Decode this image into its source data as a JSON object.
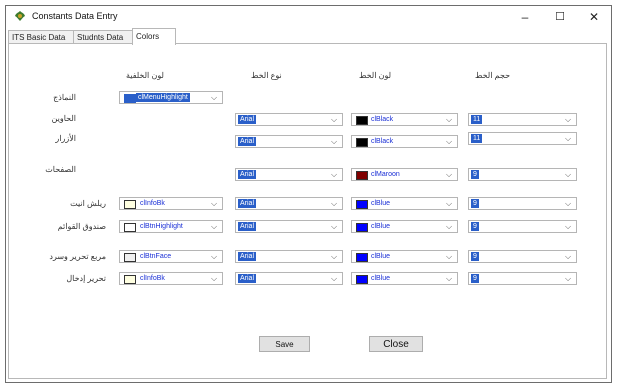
{
  "window": {
    "title": "Constants Data Entry",
    "controls": {
      "minimize": "–",
      "maximize": "☐",
      "close": "✕"
    }
  },
  "tabs": [
    {
      "label": "ITS Basic Data",
      "active": false
    },
    {
      "label": "Studnts Data",
      "active": false
    },
    {
      "label": "Colors",
      "active": true
    }
  ],
  "headers": {
    "background_color": "لون الخلفية",
    "font_type": "نوع الخط",
    "font_color": "لون الخط",
    "font_size": "حجم الخط"
  },
  "rows": [
    {
      "label": "النماذج",
      "background": {
        "value": "clMenuHighlight",
        "swatch": "#2a5fc9",
        "highlighted": true
      }
    },
    {
      "label": "الحاوين",
      "font": "Arial",
      "color": {
        "value": "clBlack",
        "swatch": "#000000"
      },
      "size": "11"
    },
    {
      "label": "الأزرار",
      "font": "Arial",
      "color": {
        "value": "clBlack",
        "swatch": "#000000"
      },
      "size": "11"
    },
    {
      "label": "الصفحات",
      "font": "Arial",
      "color": {
        "value": "clMaroon",
        "swatch": "#800000"
      },
      "size": "9"
    },
    {
      "label": "ريلش انيت",
      "background": {
        "value": "clInfoBk",
        "swatch": "#ffffe1"
      },
      "font": "Arial",
      "color": {
        "value": "clBlue",
        "swatch": "#0000ff"
      },
      "size": "9"
    },
    {
      "label": "صندوق القوائم",
      "background": {
        "value": "clBtnHighlight",
        "swatch": "#ffffff"
      },
      "font": "Arial",
      "color": {
        "value": "clBlue",
        "swatch": "#0000ff"
      },
      "size": "9"
    },
    {
      "label": "مربع تحرير وسرد",
      "background": {
        "value": "clBtnFace",
        "swatch": "#f0f0f0"
      },
      "font": "Arial",
      "color": {
        "value": "clBlue",
        "swatch": "#0000ff"
      },
      "size": "9"
    },
    {
      "label": "تحرير إدخال",
      "background": {
        "value": "clInfoBk",
        "swatch": "#ffffe1"
      },
      "font": "Arial",
      "color": {
        "value": "clBlue",
        "swatch": "#0000ff"
      },
      "size": "9"
    }
  ],
  "buttons": {
    "save": "Save",
    "close": "Close"
  },
  "colors": {
    "selection": "#2a5fc9",
    "text_blue": "#1a2fd6"
  }
}
